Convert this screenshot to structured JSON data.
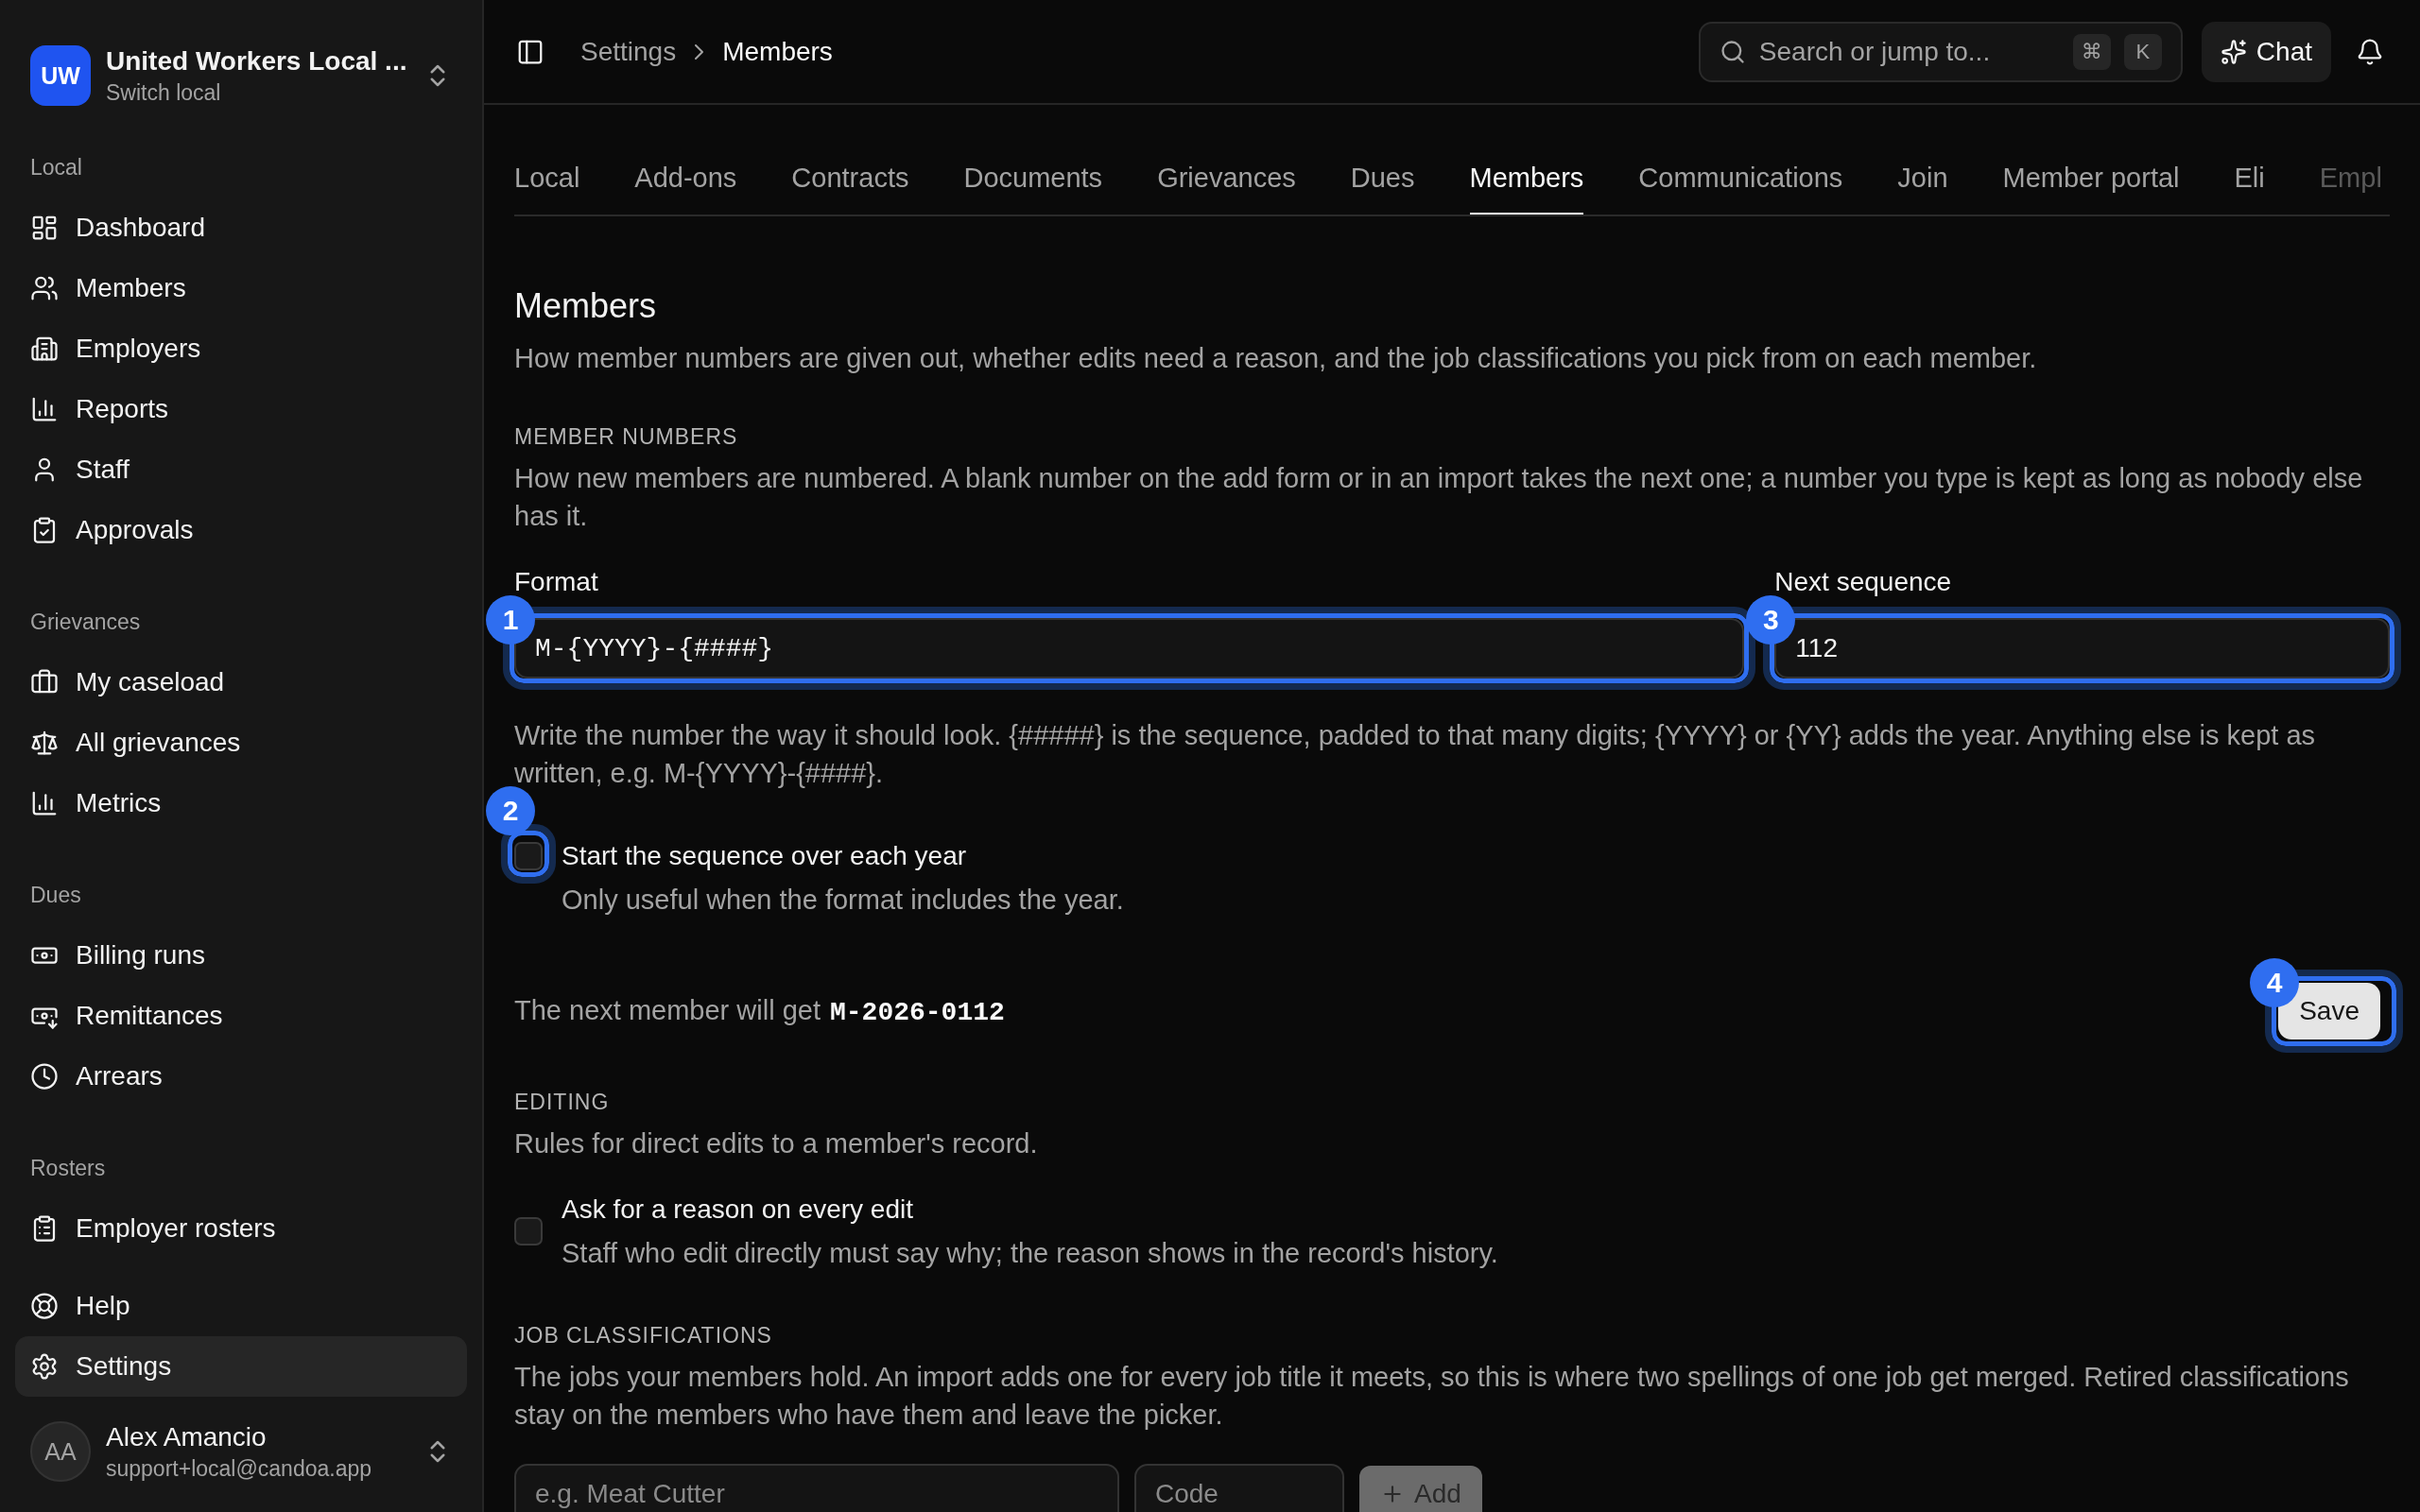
{
  "sidebar": {
    "org": {
      "initials": "UW",
      "name": "United Workers Local ...",
      "subtitle": "Switch local"
    },
    "sections": [
      {
        "title": "Local",
        "items": [
          {
            "label": "Dashboard",
            "selected": false
          },
          {
            "label": "Members",
            "selected": false
          },
          {
            "label": "Employers",
            "selected": false
          },
          {
            "label": "Reports",
            "selected": false
          },
          {
            "label": "Staff",
            "selected": false
          },
          {
            "label": "Approvals",
            "selected": false
          }
        ]
      },
      {
        "title": "Grievances",
        "items": [
          {
            "label": "My caseload",
            "selected": false
          },
          {
            "label": "All grievances",
            "selected": false
          },
          {
            "label": "Metrics",
            "selected": false
          }
        ]
      },
      {
        "title": "Dues",
        "items": [
          {
            "label": "Billing runs",
            "selected": false
          },
          {
            "label": "Remittances",
            "selected": false
          },
          {
            "label": "Arrears",
            "selected": false
          }
        ]
      },
      {
        "title": "Rosters",
        "items": [
          {
            "label": "Employer rosters",
            "selected": false
          }
        ]
      }
    ],
    "footer_items": [
      {
        "label": "Help",
        "selected": false
      },
      {
        "label": "Settings",
        "selected": true
      }
    ],
    "user": {
      "initials": "AA",
      "name": "Alex Amancio",
      "email": "support+local@candoa.app"
    }
  },
  "topbar": {
    "breadcrumb": [
      "Settings",
      "Members"
    ],
    "search": {
      "label": "Search or jump to...",
      "shortcut": [
        "⌘",
        "K"
      ]
    },
    "chat_button": "Chat"
  },
  "tabs": [
    {
      "label": "Local",
      "selected": false
    },
    {
      "label": "Add-ons",
      "selected": false
    },
    {
      "label": "Contracts",
      "selected": false
    },
    {
      "label": "Documents",
      "selected": false
    },
    {
      "label": "Grievances",
      "selected": false
    },
    {
      "label": "Dues",
      "selected": false
    },
    {
      "label": "Members",
      "selected": true
    },
    {
      "label": "Communications",
      "selected": false
    },
    {
      "label": "Join",
      "selected": false
    },
    {
      "label": "Member portal",
      "selected": false
    },
    {
      "label": "Eli",
      "selected": false
    },
    {
      "label": "Empl",
      "selected": false
    }
  ],
  "page": {
    "title": "Members",
    "description": "How member numbers are given out, whether edits need a reason, and the job classifications you pick from on each member."
  },
  "member_numbers": {
    "heading": "MEMBER NUMBERS",
    "description": "How new members are numbered. A blank number on the add form or in an import takes the next one; a number you type is kept as long as nobody else has it.",
    "format": {
      "label": "Format",
      "value": "M-{YYYY}-{####}",
      "callout": "1"
    },
    "next_sequence": {
      "label": "Next sequence",
      "value": "112",
      "callout": "3"
    },
    "help": "Write the number the way it should look. {#####} is the sequence, padded to that many digits; {YYYY} or {YY} adds the year. Anything else is kept as written, e.g. M-{YYYY}-{####}.",
    "restart": {
      "label": "Start the sequence over each year",
      "hint": "Only useful when the format includes the year.",
      "checked": false,
      "callout": "2"
    },
    "preview": {
      "label": "The next member will get",
      "value": "M-2026-0112"
    },
    "save_button": {
      "label": "Save",
      "callout": "4"
    }
  },
  "editing": {
    "heading": "EDITING",
    "description": "Rules for direct edits to a member's record.",
    "reason": {
      "label": "Ask for a reason on every edit",
      "hint": "Staff who edit directly must say why; the reason shows in the record's history.",
      "checked": false
    }
  },
  "job_classifications": {
    "heading": "JOB CLASSIFICATIONS",
    "description": "The jobs your members hold. An import adds one for every job title it meets, so this is where two spellings of one job get merged. Retired classifications stay on the members who have them and leave the picker.",
    "name_field": {
      "placeholder": "e.g. Meat Cutter"
    },
    "code_field": {
      "placeholder": "Code"
    },
    "add_button": {
      "label": "Add",
      "disabled": true
    }
  }
}
